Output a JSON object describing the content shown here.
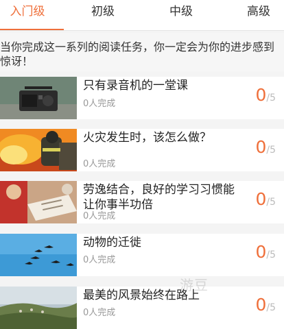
{
  "tabs": [
    {
      "label": "入门级",
      "active": true
    },
    {
      "label": "初级",
      "active": false
    },
    {
      "label": "中级",
      "active": false
    },
    {
      "label": "高级",
      "active": false
    }
  ],
  "intro": "当你完成这一系列的阅读任务，你一定会为你的进步感到惊讶！",
  "items": [
    {
      "title": "只有录音机的一堂课",
      "completed": "0人完成",
      "progress": "0",
      "total": "/5",
      "thumb": "radio"
    },
    {
      "title": "火灾发生时，该怎么做？",
      "completed": "0人完成",
      "progress": "0",
      "total": "/5",
      "thumb": "fire"
    },
    {
      "title": "劳逸结合，良好的学习习惯能让你事半功倍",
      "completed": "0人完成",
      "progress": "0",
      "total": "/5",
      "thumb": "study"
    },
    {
      "title": "动物的迁徙",
      "completed": "0人完成",
      "progress": "0",
      "total": "/5",
      "thumb": "birds"
    },
    {
      "title": "最美的风景始终在路上",
      "completed": "0人完成",
      "progress": "0",
      "total": "/5",
      "thumb": "landscape"
    }
  ],
  "watermark": "游豆",
  "colors": {
    "accent": "#ef6f3a",
    "text": "#222222",
    "muted": "#999999"
  }
}
